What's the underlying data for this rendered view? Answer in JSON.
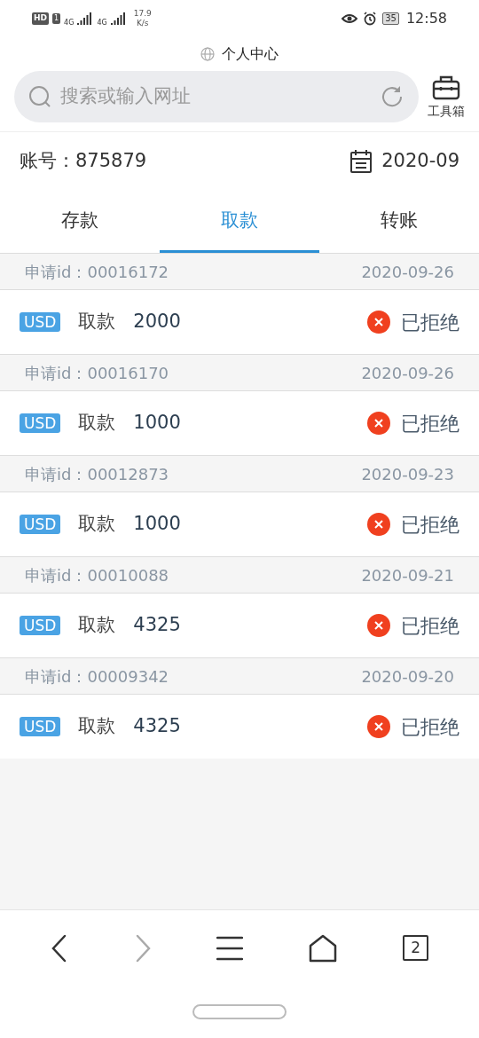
{
  "status_bar": {
    "hd": "HD",
    "sim": "1",
    "signal_1": "4G",
    "signal_2": "4G",
    "speed": "17.9",
    "speed_unit": "K/s",
    "battery": "35",
    "time": "12:58"
  },
  "page_title": "个人中心",
  "search": {
    "placeholder": "搜索或输入网址"
  },
  "toolbox": {
    "label": "工具箱"
  },
  "account": {
    "label": "账号：875879",
    "month": "2020-09"
  },
  "tabs": [
    {
      "label": "存款",
      "selected": false
    },
    {
      "label": "取款",
      "selected": true
    },
    {
      "label": "转账",
      "selected": false
    }
  ],
  "records": [
    {
      "id_label": "申请id：",
      "id": "00016172",
      "date": "2020-09-26",
      "currency": "USD",
      "type": "取款",
      "amount": "2000",
      "status": "已拒绝"
    },
    {
      "id_label": "申请id：",
      "id": "00016170",
      "date": "2020-09-26",
      "currency": "USD",
      "type": "取款",
      "amount": "1000",
      "status": "已拒绝"
    },
    {
      "id_label": "申请id：",
      "id": "00012873",
      "date": "2020-09-23",
      "currency": "USD",
      "type": "取款",
      "amount": "1000",
      "status": "已拒绝"
    },
    {
      "id_label": "申请id：",
      "id": "00010088",
      "date": "2020-09-21",
      "currency": "USD",
      "type": "取款",
      "amount": "4325",
      "status": "已拒绝"
    },
    {
      "id_label": "申请id：",
      "id": "00009342",
      "date": "2020-09-20",
      "currency": "USD",
      "type": "取款",
      "amount": "4325",
      "status": "已拒绝"
    }
  ],
  "nav": {
    "back_disabled": false,
    "forward_disabled": true,
    "tab_count": "2"
  }
}
